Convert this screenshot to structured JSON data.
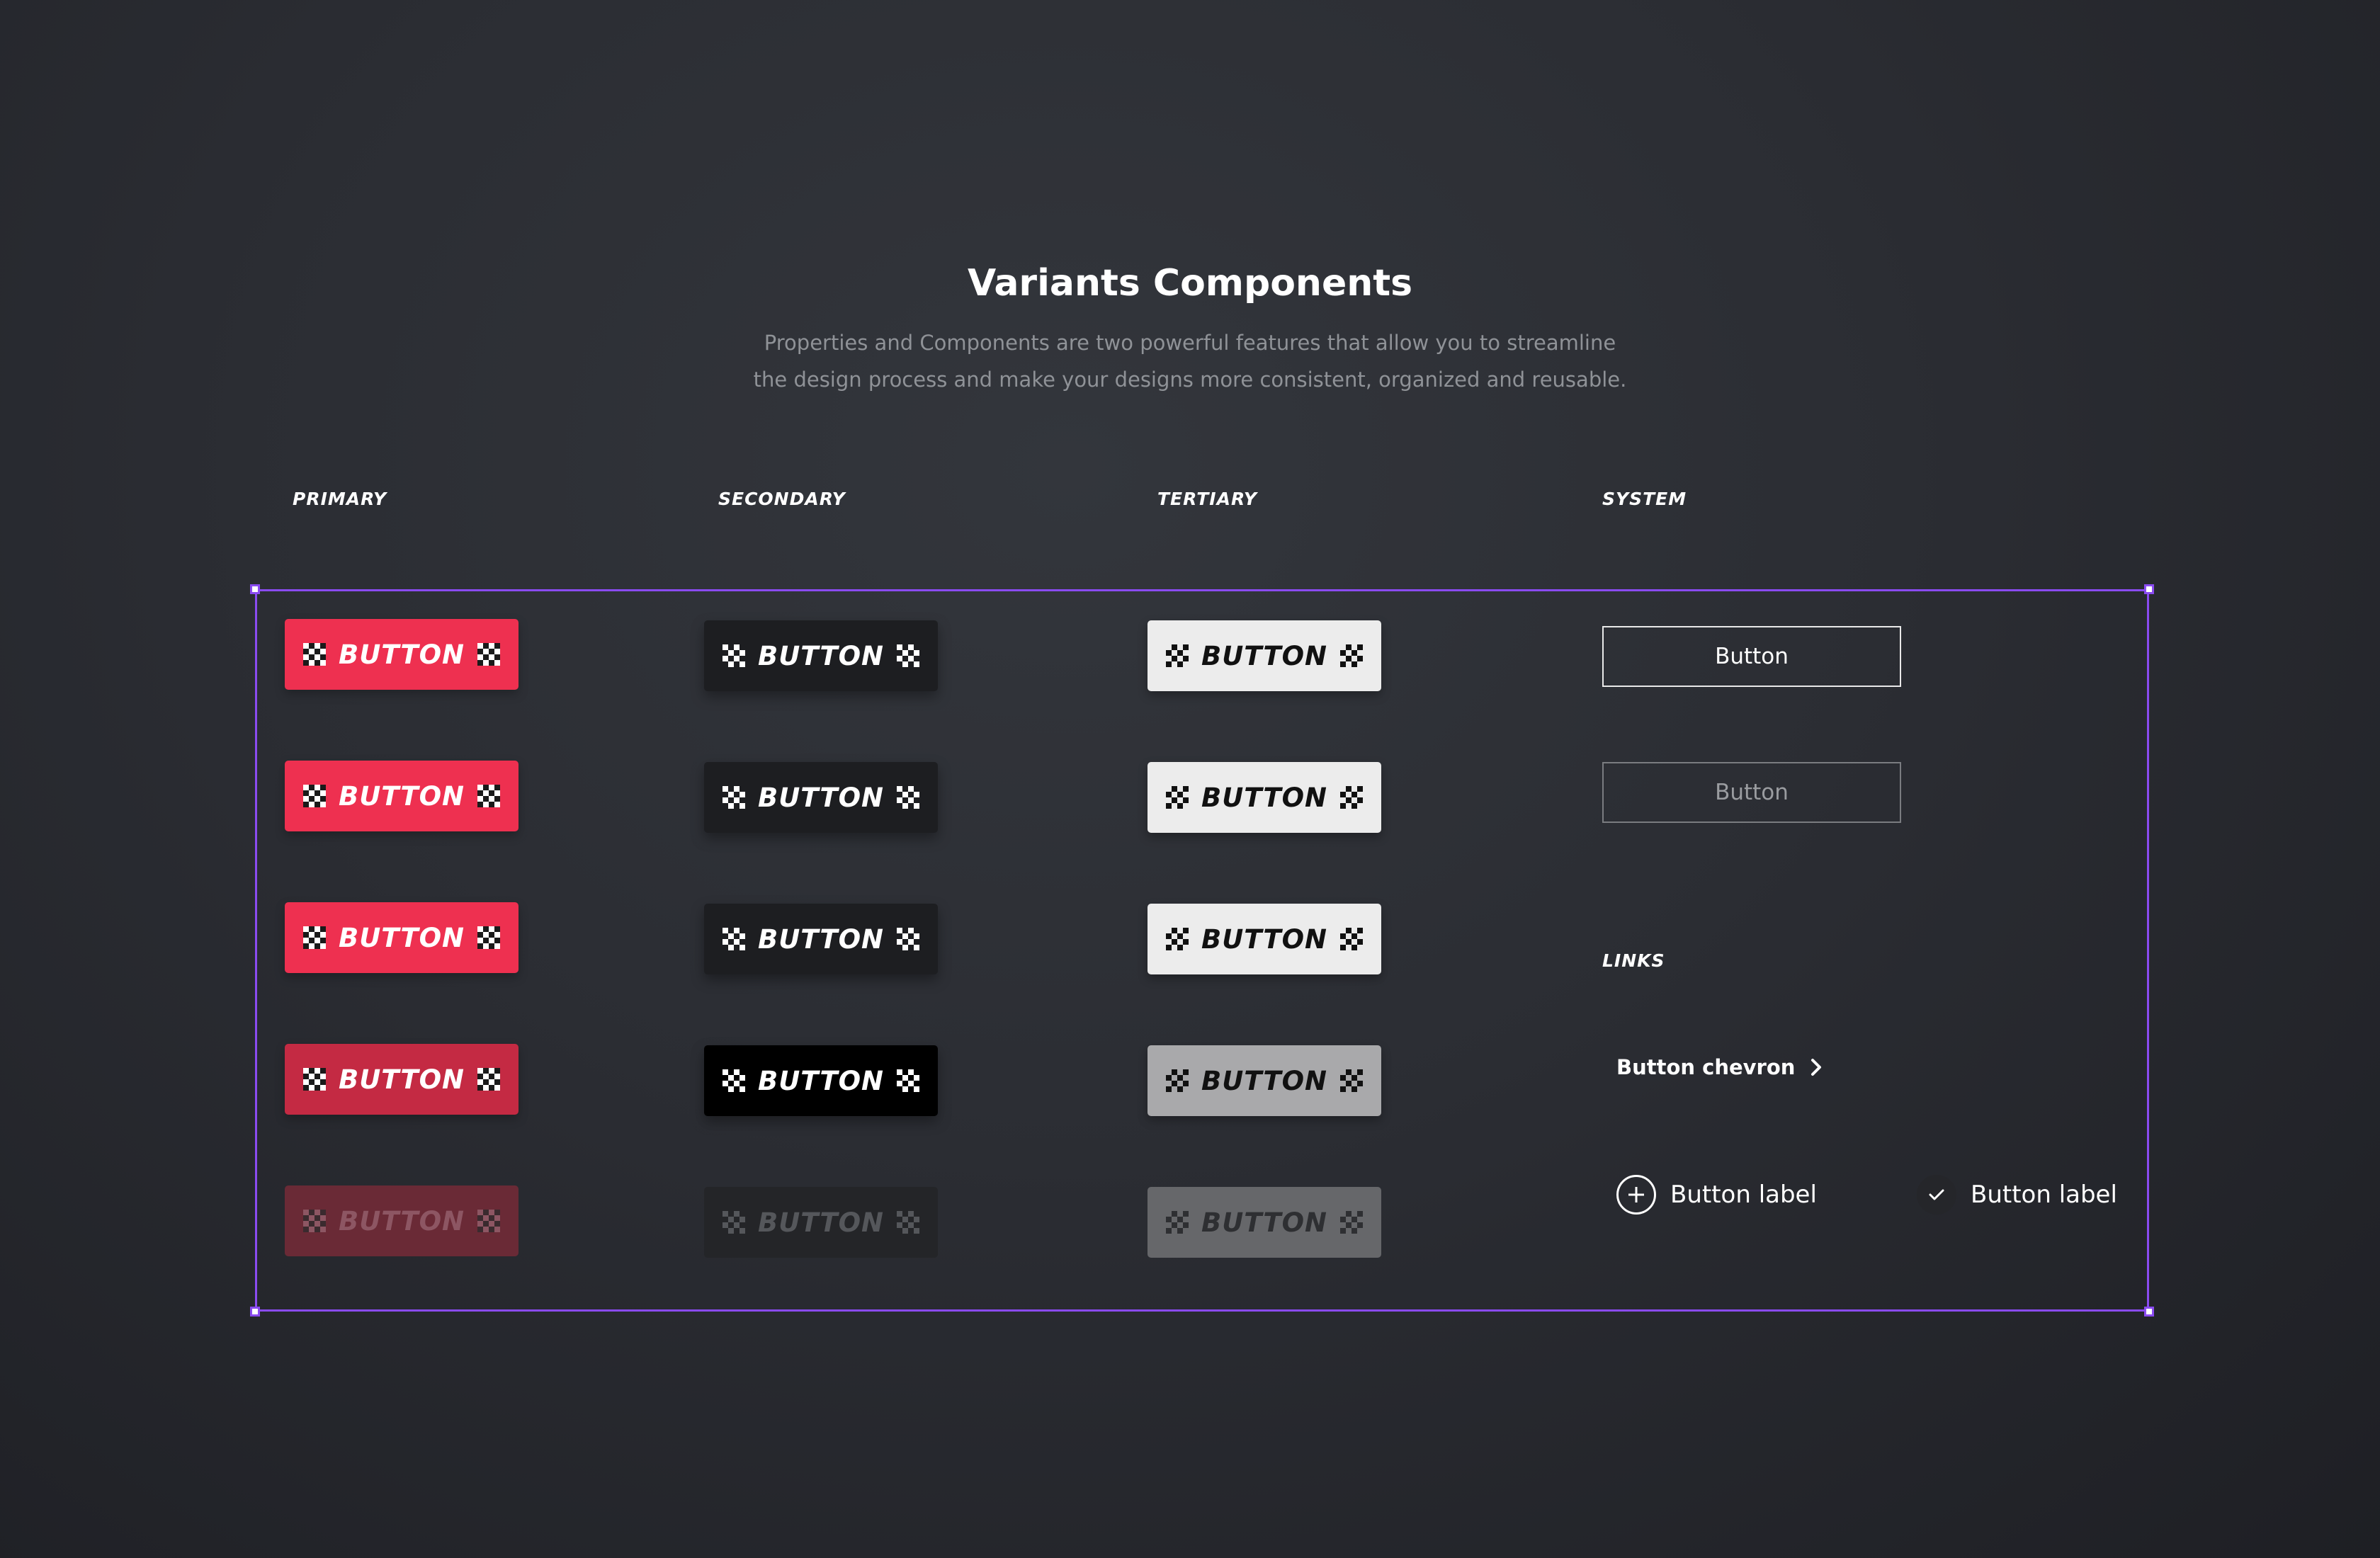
{
  "header": {
    "title": "Variants Components",
    "subtitle_line1": "Properties and Components are two powerful features that allow you to streamline",
    "subtitle_line2": "the design process and make your designs more consistent, organized and reusable."
  },
  "columns": {
    "primary": "PRIMARY",
    "secondary": "SECONDARY",
    "tertiary": "TERTIARY",
    "system": "SYSTEM"
  },
  "variant_buttons": {
    "label": "BUTTON",
    "states": [
      "default",
      "hover",
      "focus",
      "pressed",
      "disabled"
    ]
  },
  "system": {
    "button_default": "Button",
    "button_disabled": "Button"
  },
  "links": {
    "heading": "LINKS",
    "chevron_link": "Button chevron",
    "add_label": "Button label",
    "check_label": "Button label"
  },
  "colors": {
    "primary": "#ee3050",
    "secondary": "#1d1e21",
    "tertiary": "#ececec",
    "selection_frame": "#8a4bf0",
    "background": "#2b2d33"
  },
  "icons": [
    "checker-icon",
    "chevron-right-icon",
    "plus-circle-icon",
    "check-icon"
  ]
}
